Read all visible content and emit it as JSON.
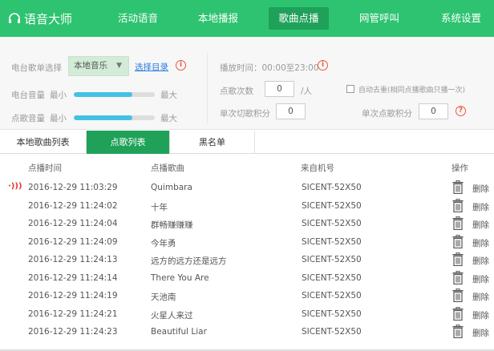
{
  "app": {
    "title": "语音大师"
  },
  "nav": [
    {
      "label": "活动语音",
      "active": false
    },
    {
      "label": "本地播报",
      "active": false
    },
    {
      "label": "歌曲点播",
      "active": true
    },
    {
      "label": "网管呼叫",
      "active": false
    },
    {
      "label": "系统设置",
      "active": false
    }
  ],
  "settings": {
    "source_label": "电台歌单选择",
    "source_value": "本地音乐",
    "select_catalog_link": "选择目录",
    "radio_volume_label": "电台音量",
    "radio_volume_min": "最小",
    "radio_volume_max": "最大",
    "radio_volume_level": 0.72,
    "request_volume_label": "点歌音量",
    "request_volume_min": "最小",
    "request_volume_max": "最大",
    "request_volume_level": 0.72,
    "play_time_label": "播放时间：00:00至23:00",
    "request_count_label": "点歌次数",
    "request_count_value": "0",
    "request_count_unit": "/人",
    "auto_dedupe_label": "自动去重(相同点播歌曲只播一次)",
    "single_cut_points_label": "单次切歌积分",
    "single_cut_points_value": "0",
    "single_request_points_label": "单次点歌积分",
    "single_request_points_value": "0"
  },
  "tabs": [
    {
      "label": "本地歌曲列表",
      "active": false
    },
    {
      "label": "点歌列表",
      "active": true
    },
    {
      "label": "黑名单",
      "active": false
    }
  ],
  "table": {
    "headers": [
      "点播时间",
      "点播歌曲",
      "来自机号",
      "操作"
    ],
    "delete_label": "删除",
    "rows": [
      {
        "time": "2016-12-29 11:03:29",
        "song": "Quimbara",
        "from": "SICENT-52X50",
        "playing": true
      },
      {
        "time": "2016-12-29 11:24:02",
        "song": "十年",
        "from": "SICENT-52X50",
        "playing": false
      },
      {
        "time": "2016-12-29 11:24:04",
        "song": "群畅赚赚赚",
        "from": "SICENT-52X50",
        "playing": false
      },
      {
        "time": "2016-12-29 11:24:09",
        "song": "今年勇",
        "from": "SICENT-52X50",
        "playing": false
      },
      {
        "time": "2016-12-29 11:24:13",
        "song": "远方的远方还是远方",
        "from": "SICENT-52X50",
        "playing": false
      },
      {
        "time": "2016-12-29 11:24:14",
        "song": "There You Are",
        "from": "SICENT-52X50",
        "playing": false
      },
      {
        "time": "2016-12-29 11:24:19",
        "song": "天池南",
        "from": "SICENT-52X50",
        "playing": false
      },
      {
        "time": "2016-12-29 11:24:21",
        "song": "火星人来过",
        "from": "SICENT-52X50",
        "playing": false
      },
      {
        "time": "2016-12-29 11:24:23",
        "song": "Beautiful Liar",
        "from": "SICENT-52X50",
        "playing": false
      }
    ]
  },
  "colors": {
    "brand_green": "#2ec370",
    "active_green": "#1fa159",
    "slider_blue": "#45c1e4",
    "alert_red": "#f0563c",
    "link_blue": "#2b7de0"
  },
  "icons": {
    "brand": "headphones-icon",
    "info": "info-icon",
    "help": "help-icon",
    "playing": "sound-wave-icon",
    "delete": "trash-icon",
    "dropdown": "caret-down-icon"
  }
}
